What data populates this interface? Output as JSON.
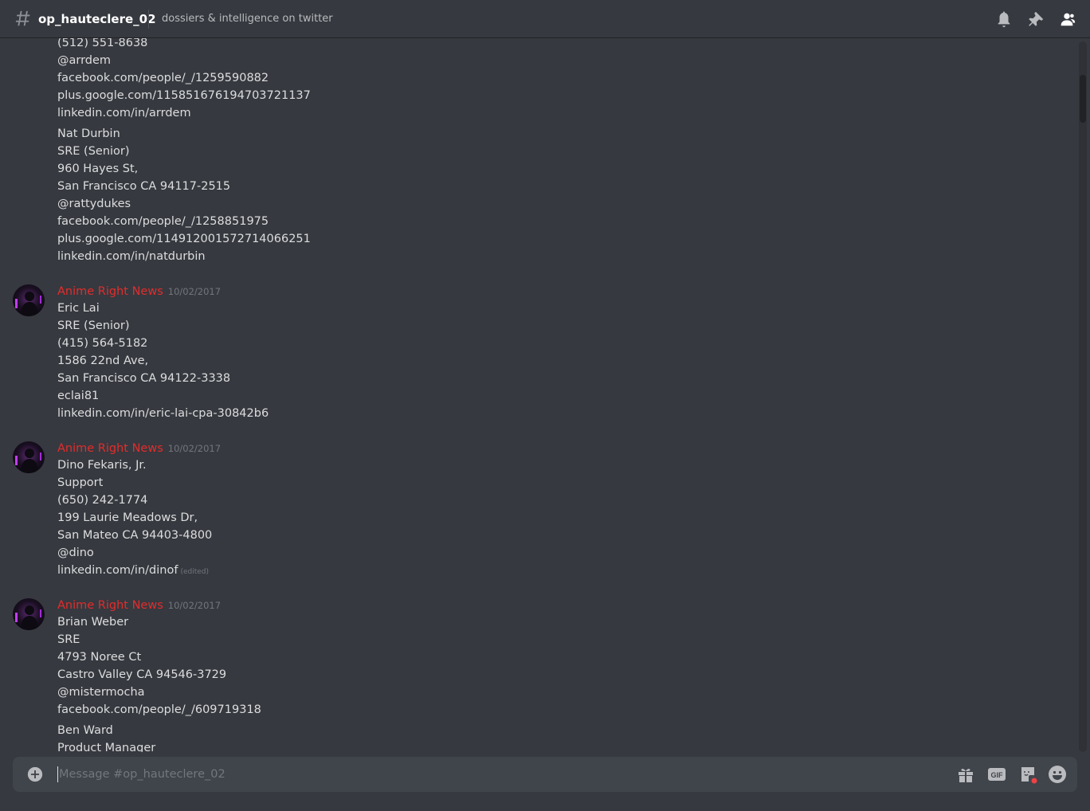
{
  "header": {
    "channel_name": "op_hauteclere_02",
    "topic": "dossiers & intelligence on twitter",
    "icons": [
      "hash-icon",
      "bell-icon",
      "pin-icon",
      "members-icon"
    ]
  },
  "messages": {
    "continuation": {
      "lines": [
        "(512) 551-8638",
        "@arrdem",
        "facebook.com/people/_/1259590882",
        "plus.google.com/115851676194703721137",
        "linkedin.com/in/arrdem"
      ],
      "block2": [
        "Nat Durbin",
        "SRE (Senior)",
        "960 Hayes St,",
        "San Francisco CA 94117-2515",
        "@rattydukes",
        "facebook.com/people/_/1258851975",
        "plus.google.com/114912001572714066251",
        "linkedin.com/in/natdurbin"
      ]
    },
    "groups": [
      {
        "author": "Anime Right News",
        "timestamp": "10/02/2017",
        "lines": [
          "Eric Lai",
          "SRE (Senior)",
          "(415) 564-5182",
          "1586 22nd Ave,",
          "San Francisco CA 94122-3338",
          "eclai81",
          "linkedin.com/in/eric-lai-cpa-30842b6"
        ]
      },
      {
        "author": "Anime Right News",
        "timestamp": "10/02/2017",
        "lines": [
          "Dino Fekaris, Jr.",
          "Support",
          "(650) 242-1774",
          "199 Laurie Meadows Dr,",
          "San Mateo CA 94403-4800",
          "@dino",
          "linkedin.com/in/dinof"
        ],
        "edited": "(edited)"
      },
      {
        "author": "Anime Right News",
        "timestamp": "10/02/2017",
        "lines": [
          "Brian Weber",
          "SRE",
          "4793 Noree Ct",
          "Castro Valley CA 94546-3729",
          "@mistermocha",
          "facebook.com/people/_/609719318"
        ],
        "block2": [
          "Ben Ward",
          "Product Manager"
        ]
      }
    ]
  },
  "composer": {
    "placeholder": "Message #op_hauteclere_02",
    "icons": [
      "plus-icon",
      "gift-icon",
      "gif-icon",
      "sticker-icon",
      "emoji-icon"
    ],
    "gif_label": "GIF"
  },
  "colors": {
    "background": "#36393f",
    "author": "#e32c2c",
    "text": "#dcddde",
    "muted": "#72767d",
    "composer": "#40444b"
  }
}
